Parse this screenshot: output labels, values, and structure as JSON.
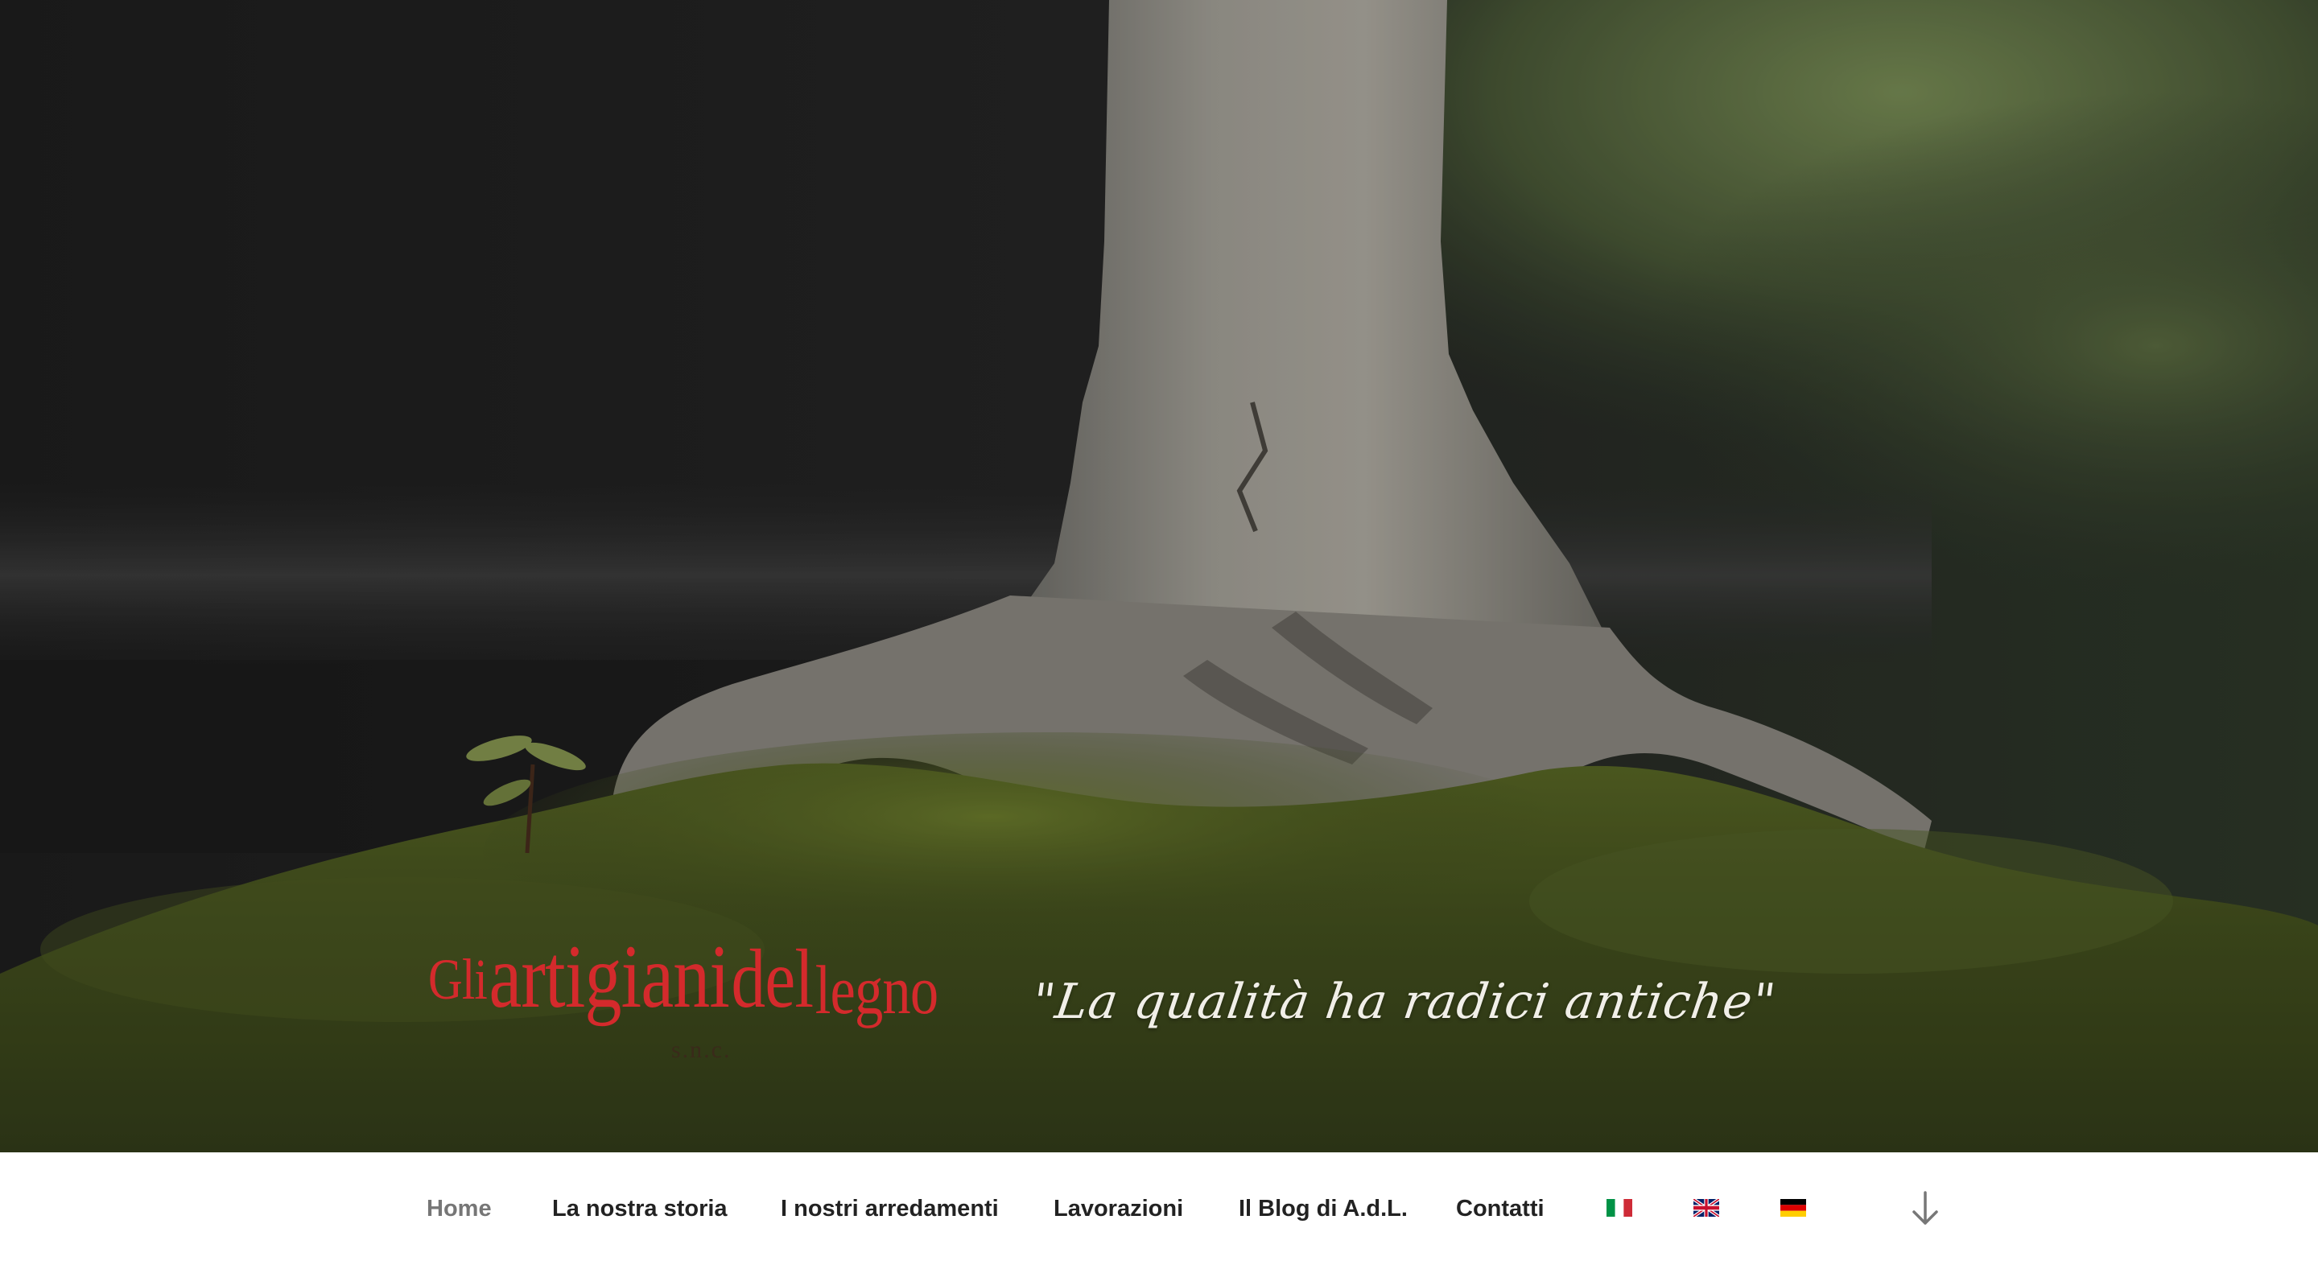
{
  "hero": {
    "logo": {
      "words": [
        "Gli",
        "artigiani",
        "del",
        "legno"
      ],
      "suffix": "s.n.c.",
      "color": "#d42a2c"
    },
    "tagline": "\"La qualità ha radici antiche\""
  },
  "nav": {
    "items": [
      {
        "label": "Home",
        "current": true
      },
      {
        "label": "La nostra storia"
      },
      {
        "label": "I nostri arredamenti"
      },
      {
        "label": "Lavorazioni"
      },
      {
        "label": "Il Blog di A.d.L."
      },
      {
        "label": "Contatti"
      }
    ],
    "languages": [
      {
        "code": "it",
        "icon": "italian-flag-icon"
      },
      {
        "code": "en",
        "icon": "uk-flag-icon"
      },
      {
        "code": "de",
        "icon": "german-flag-icon"
      }
    ],
    "scroll_icon": "arrow-down-icon",
    "colors": {
      "text": "#222222",
      "current": "#767676"
    }
  }
}
